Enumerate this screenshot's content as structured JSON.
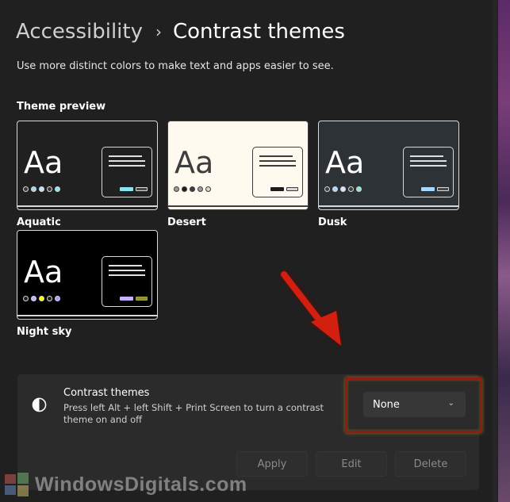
{
  "breadcrumb": {
    "parent": "Accessibility",
    "separator": "›",
    "current": "Contrast themes"
  },
  "description": "Use more distinct colors to make text and apps easier to see.",
  "preview_section": {
    "title": "Theme preview",
    "themes": [
      {
        "name": "Aquatic",
        "sample": "Aa",
        "bg": "#202020",
        "fg": "#ffffff",
        "border": "#d8d8d8",
        "accent1": "#8ee3f0",
        "accent2": "#4a4a4a",
        "dots": [
          "#3a3a3a",
          "#9fd6ea",
          "#b8e6f5",
          "#3a3a3a",
          "#8ee3f0"
        ]
      },
      {
        "name": "Desert",
        "sample": "Aa",
        "bg": "#fffaef",
        "fg": "#3d3d3d",
        "border": "#3d3d3d",
        "accent1": "#1c1c1c",
        "accent2": "#d8d8d8",
        "dots": [
          "#9c9c9c",
          "#1c1c1c",
          "#3d3d3d",
          "#9c9c9c",
          "#d8d8d8"
        ]
      },
      {
        "name": "Dusk",
        "sample": "Aa",
        "bg": "#2d3236",
        "fg": "#ffffff",
        "border": "#d8d8d8",
        "accent1": "#a6d8ff",
        "accent2": "#4a4a4a",
        "dots": [
          "#3a3f45",
          "#a6d8ff",
          "#d0e6ff",
          "#3a3f45",
          "#8ee3d6"
        ]
      },
      {
        "name": "Night sky",
        "sample": "Aa",
        "bg": "#000000",
        "fg": "#ffffff",
        "border": "#d8d8d8",
        "accent1": "#c6b0ff",
        "accent2": "#8e8e33",
        "dots": [
          "#1f1f1f",
          "#c6b0ff",
          "#ffff00",
          "#1f1f1f",
          "#a79cff"
        ]
      }
    ]
  },
  "contrast_setting": {
    "title": "Contrast themes",
    "description": "Press left Alt + left Shift + Print Screen to turn a contrast theme on and off",
    "dropdown_value": "None",
    "buttons": {
      "apply": "Apply",
      "edit": "Edit",
      "delete": "Delete"
    }
  },
  "watermark": "WindowsDigitals.com",
  "colors": {
    "background": "#202020",
    "card": "#2b2b2b",
    "highlight": "#8b1d12",
    "arrow": "#d21f0f"
  }
}
